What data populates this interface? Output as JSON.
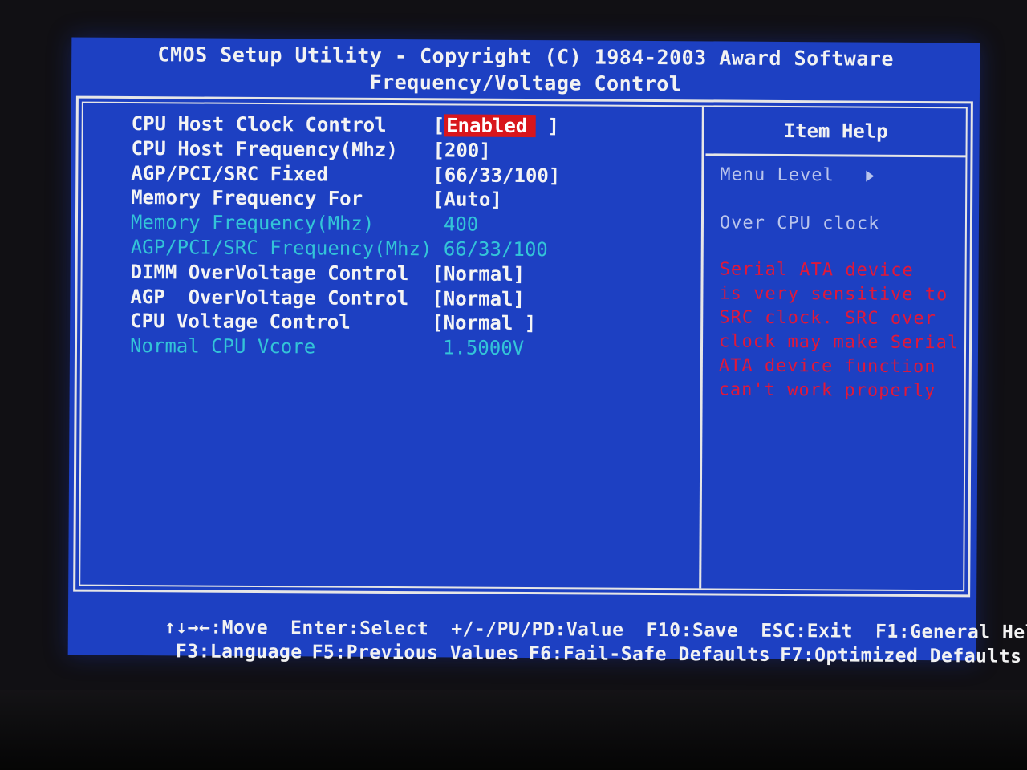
{
  "header": {
    "title": "CMOS Setup Utility - Copyright (C) 1984-2003 Award Software",
    "subtitle": "Frequency/Voltage Control"
  },
  "settings": [
    {
      "label": "CPU Host Clock Control",
      "value_open": "[",
      "value": "Enabled",
      "value_close": " ]",
      "state": "selected"
    },
    {
      "label": "CPU Host Frequency(Mhz)",
      "value": "[200]",
      "state": "active"
    },
    {
      "label": "AGP/PCI/SRC Fixed",
      "value": "[66/33/100]",
      "state": "active"
    },
    {
      "label": "Memory Frequency For",
      "value": "[Auto]",
      "state": "active"
    },
    {
      "label": "Memory Frequency(Mhz)",
      "value": "400",
      "state": "readonly"
    },
    {
      "label": "AGP/PCI/SRC Frequency(Mhz)",
      "value": "66/33/100",
      "state": "readonly"
    },
    {
      "label": "DIMM OverVoltage Control",
      "value": "[Normal]",
      "state": "active"
    },
    {
      "label": "AGP  OverVoltage Control",
      "value": "[Normal]",
      "state": "active"
    },
    {
      "label": "CPU Voltage Control",
      "value": "[Normal ]",
      "state": "active"
    },
    {
      "label": "Normal CPU Vcore",
      "value": "1.5000V",
      "state": "readonly"
    }
  ],
  "help": {
    "title": "Item Help",
    "menu_level": "Menu Level",
    "description": "Over CPU clock",
    "warning": [
      "Serial ATA device",
      "is very sensitive to",
      "SRC clock. SRC over",
      "clock may make Serial",
      "ATA device function",
      "can't work properly"
    ]
  },
  "footer": {
    "line1": [
      {
        "key": "↑↓→←",
        "label": ":Move"
      },
      {
        "key": "Enter",
        "label": ":Select"
      },
      {
        "key": "+/-/PU/PD",
        "label": ":Value"
      },
      {
        "key": "F10",
        "label": ":Save"
      },
      {
        "key": "ESC",
        "label": ":Exit"
      },
      {
        "key": "F1",
        "label": ":General Help"
      }
    ],
    "line2": [
      {
        "key": "F3",
        "label": ":Language"
      },
      {
        "key": "F5",
        "label": ":Previous Values"
      },
      {
        "key": "F6",
        "label": ":Fail-Safe Defaults"
      },
      {
        "key": "F7",
        "label": ":Optimized Defaults"
      }
    ]
  },
  "colors": {
    "background": "#1d40c2",
    "highlight": "#d8161c",
    "readonly_text": "#33c4d8",
    "warning_text": "#e0183a"
  }
}
